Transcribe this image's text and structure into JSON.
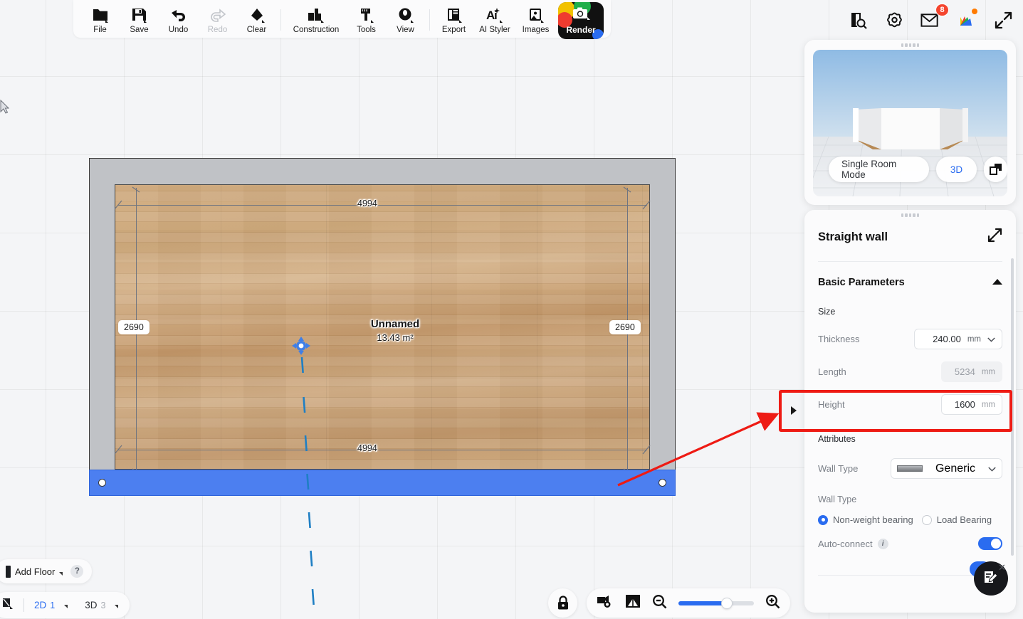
{
  "toolbar": {
    "items": [
      {
        "label": "File",
        "icon": "folder-icon",
        "disabled": false
      },
      {
        "label": "Save",
        "icon": "save-disk-icon",
        "disabled": false
      },
      {
        "label": "Undo",
        "icon": "undo-arrow-icon",
        "disabled": false
      },
      {
        "label": "Redo",
        "icon": "redo-arrow-icon",
        "disabled": true
      },
      {
        "label": "Clear",
        "icon": "eraser-icon",
        "disabled": false
      },
      {
        "label": "Construction",
        "icon": "construction-icon",
        "disabled": false
      },
      {
        "label": "Tools",
        "icon": "tools-ruler-icon",
        "disabled": false
      },
      {
        "label": "View",
        "icon": "eye-view-icon",
        "disabled": false
      },
      {
        "label": "Export",
        "icon": "export-page-icon",
        "disabled": false
      },
      {
        "label": "AI Styler",
        "icon": "ai-styler-icon",
        "disabled": false
      },
      {
        "label": "Images",
        "icon": "images-icon",
        "disabled": false
      }
    ],
    "render_label": "Render"
  },
  "topright": {
    "mail_badge": "8"
  },
  "plan": {
    "room_name": "Unnamed",
    "room_area": "13.43 m²",
    "dim_top": "4994",
    "dim_bottom": "4994",
    "dim_left": "2690",
    "dim_right": "2690"
  },
  "preview": {
    "single_room_mode": "Single Room Mode",
    "mode_3d": "3D"
  },
  "props": {
    "title": "Straight wall",
    "section": "Basic Parameters",
    "size_label": "Size",
    "thickness_label": "Thickness",
    "thickness_value": "240.00",
    "thickness_unit": "mm",
    "length_label": "Length",
    "length_value": "5234",
    "length_unit": "mm",
    "height_label": "Height",
    "height_value": "1600",
    "height_unit": "mm",
    "attributes_label": "Attributes",
    "wall_type_label": "Wall Type",
    "wall_type_value": "Generic",
    "wall_type_label2": "Wall Type",
    "radio_non_weight": "Non-weight bearing",
    "radio_load_bearing": "Load Bearing",
    "auto_connect_label": "Auto-connect",
    "auto_connect_info": "i"
  },
  "bottomleft": {
    "add_floor": "Add Floor",
    "help": "?",
    "mode_2d_label": "2D",
    "mode_2d_count": "1",
    "mode_3d_label": "3D",
    "mode_3d_count": "3"
  },
  "colors": {
    "accent_blue": "#2a6cf0",
    "selected_wall": "#4c7ff0",
    "annotation_red": "#ee1b14",
    "badge_red": "#f4452f"
  }
}
